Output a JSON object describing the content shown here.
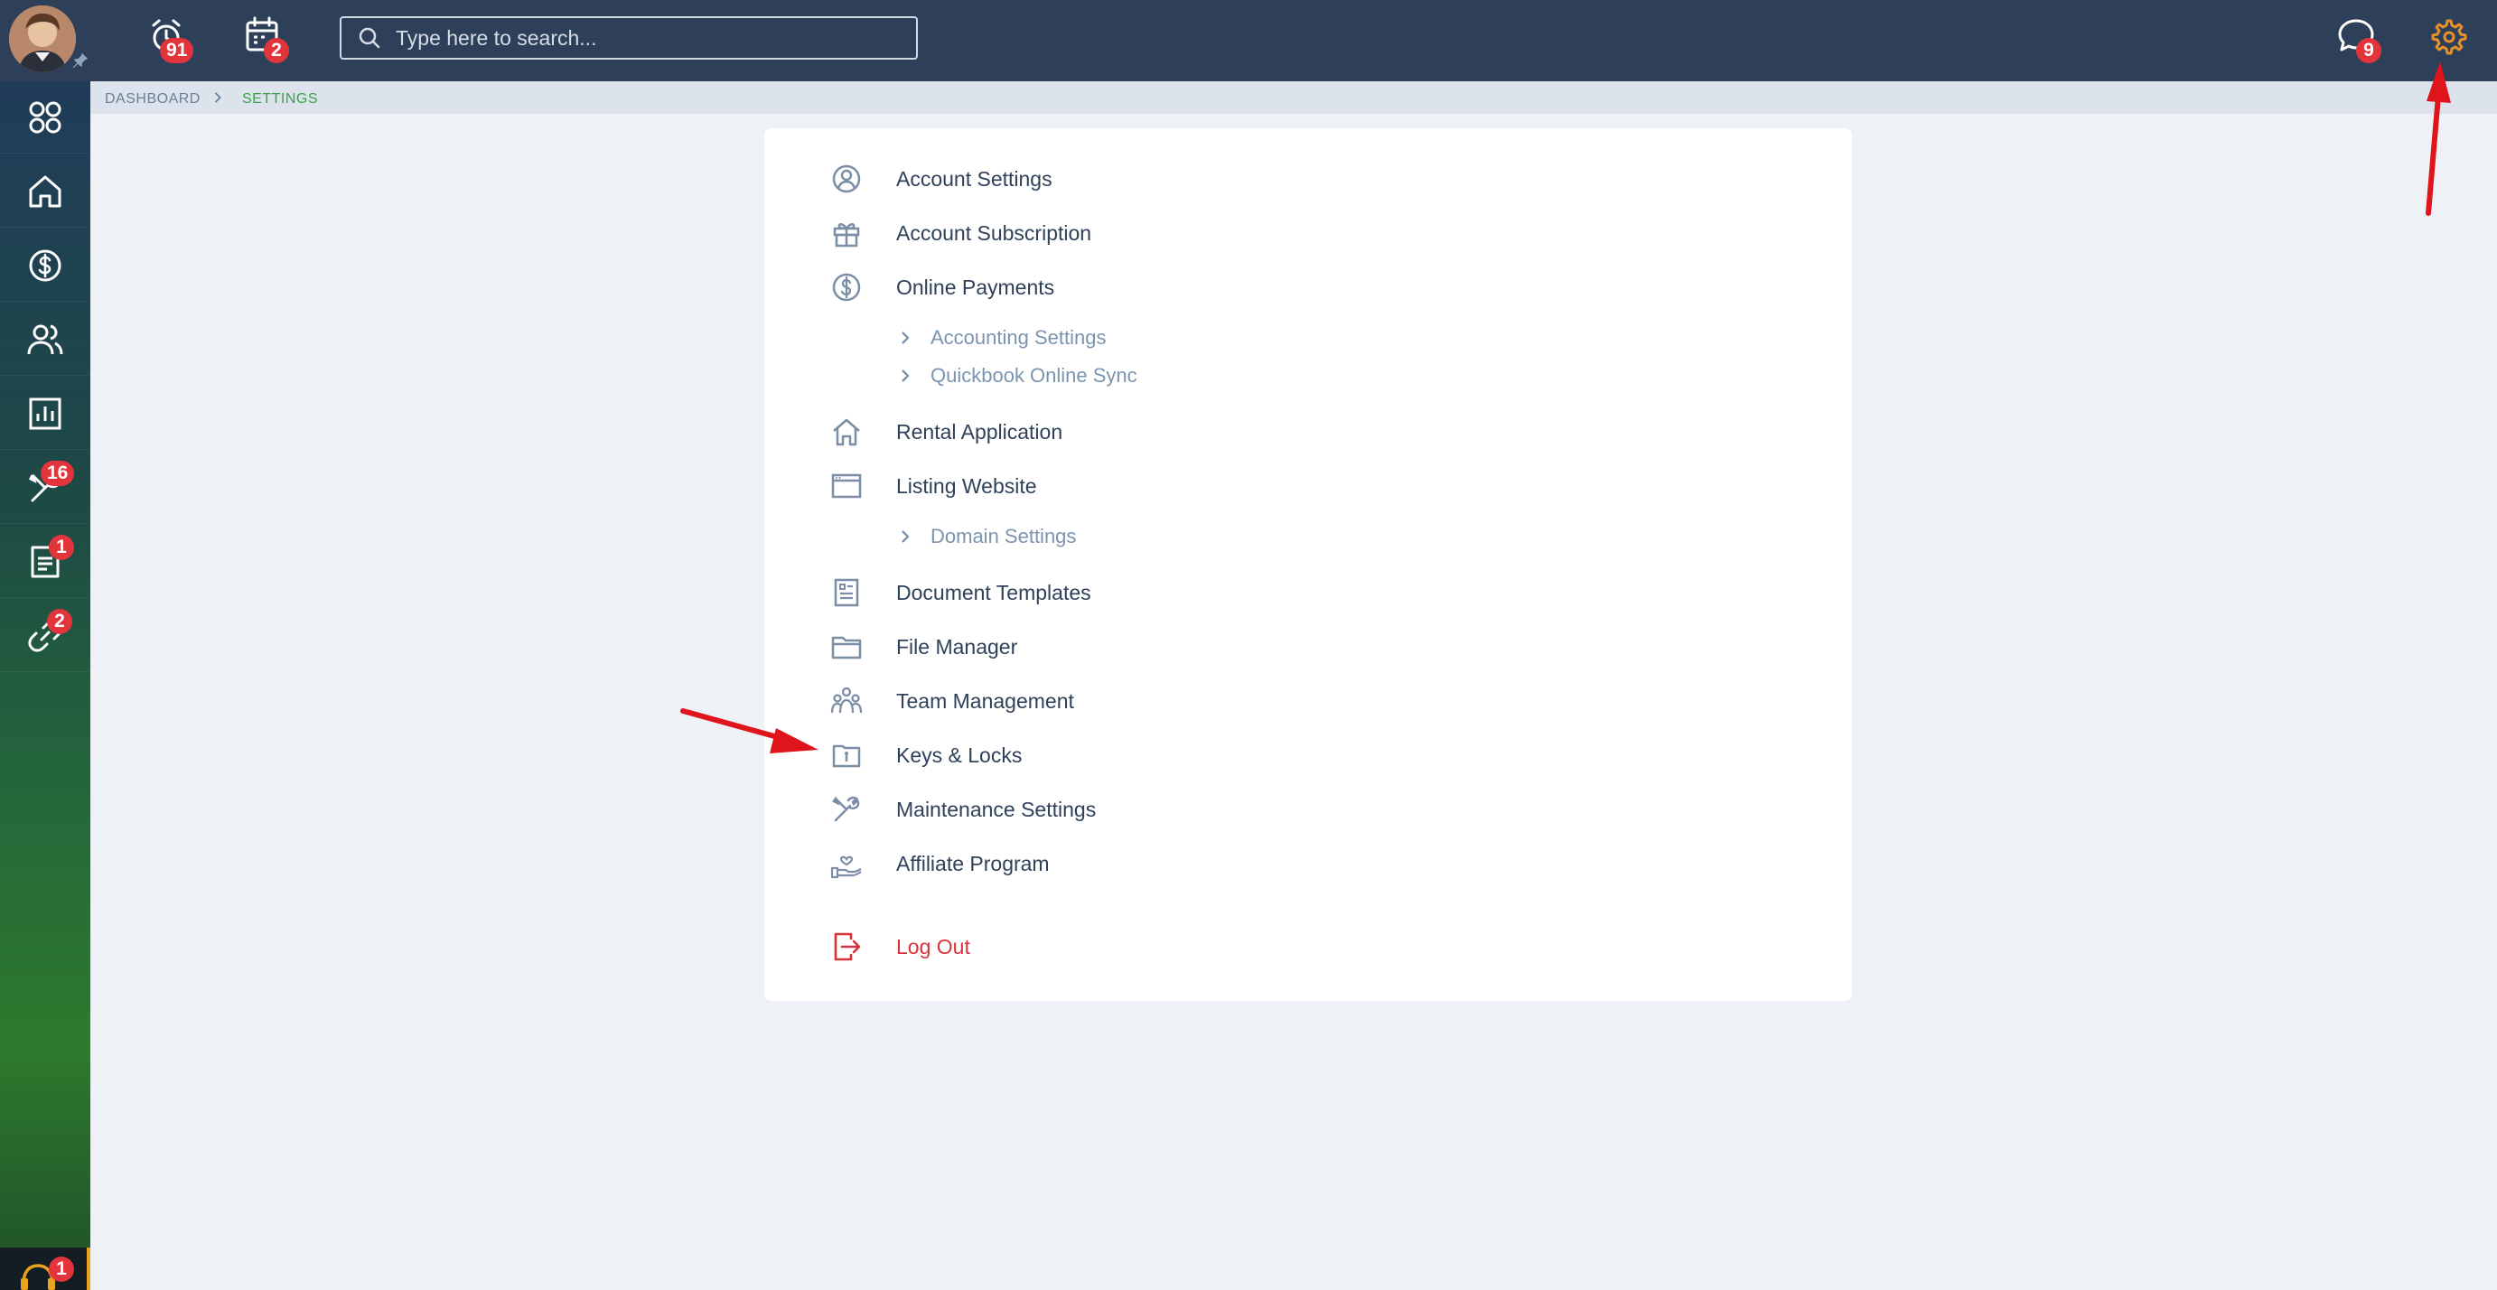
{
  "topbar": {
    "reminders_badge": "91",
    "calendar_badge": "2",
    "search_placeholder": "Type here to search...",
    "messages_badge": "9"
  },
  "sidebar": {
    "maintenance_badge": "16",
    "documents_badge": "1",
    "integrations_badge": "2",
    "support_badge": "1"
  },
  "breadcrumb": {
    "home": "DASHBOARD",
    "current": "SETTINGS"
  },
  "settings_menu": {
    "account_settings": "Account Settings",
    "account_subscription": "Account Subscription",
    "online_payments": "Online Payments",
    "accounting_settings": "Accounting Settings",
    "quickbook_sync": "Quickbook Online Sync",
    "rental_application": "Rental Application",
    "listing_website": "Listing Website",
    "domain_settings": "Domain Settings",
    "document_templates": "Document Templates",
    "file_manager": "File Manager",
    "team_management": "Team Management",
    "keys_locks": "Keys & Locks",
    "maintenance_settings": "Maintenance Settings",
    "affiliate_program": "Affiliate Program",
    "log_out": "Log Out"
  },
  "colors": {
    "topbar": "#2e4059",
    "gear_active": "#e8912a",
    "badge": "#e2343b",
    "breadcrumb_current": "#3aa447",
    "logout": "#d8333a",
    "annotation_arrow": "#e0141b"
  }
}
